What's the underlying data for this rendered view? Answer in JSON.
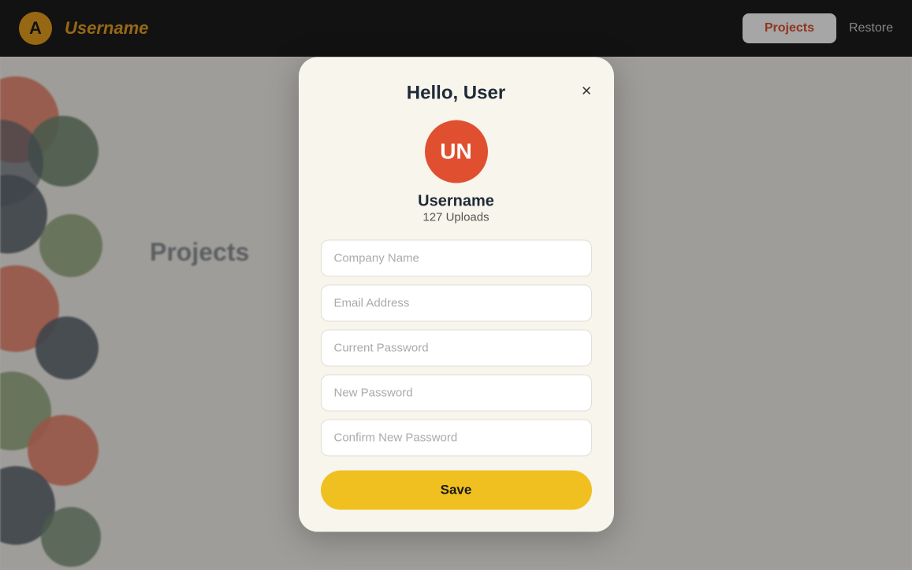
{
  "navbar": {
    "logo_text": "A",
    "brand": "Username",
    "projects_btn": "Projects",
    "restore_btn": "Restore"
  },
  "modal": {
    "title": "Hello, User",
    "close_label": "×",
    "avatar_initials": "UN",
    "username": "Username",
    "uploads": "127 Uploads",
    "fields": {
      "company_placeholder": "Company Name",
      "email_placeholder": "Email Address",
      "current_password_placeholder": "Current Password",
      "new_password_placeholder": "New Password",
      "confirm_password_placeholder": "Confirm New Password"
    },
    "save_button": "Save"
  },
  "background": {
    "page_title": "Projects"
  }
}
